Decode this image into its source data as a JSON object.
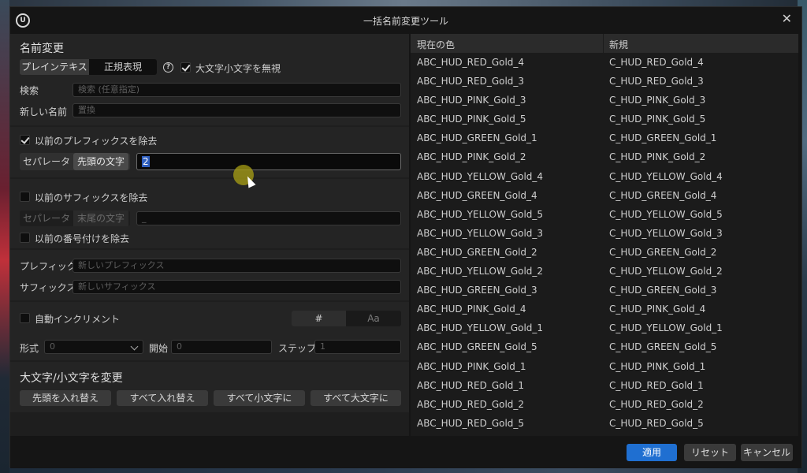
{
  "window": {
    "title": "一括名前変更ツール",
    "logo": "U",
    "close": "✕"
  },
  "rename": {
    "heading": "名前変更",
    "mode_plain": "プレインテキスト",
    "mode_regex": "正規表現",
    "ignore_case": "大文字小文字を無視",
    "search_label": "検索",
    "search_placeholder": "検索 (任意指定)",
    "newname_label": "新しい名前",
    "newname_placeholder": "置換"
  },
  "prefix_remove": {
    "checkbox": "以前のプレフィックスを除去",
    "separator": "セパレータ",
    "leading": "先頭の文字",
    "value": "2"
  },
  "suffix_remove": {
    "checkbox": "以前のサフィックスを除去",
    "separator": "セパレータ",
    "trailing": "末尾の文字",
    "value": "_",
    "numbering": "以前の番号付けを除去"
  },
  "prefix_suffix": {
    "prefix_label": "プレフィック.",
    "prefix_placeholder": "新しいプレフィックス",
    "suffix_label": "サフィックス",
    "suffix_placeholder": "新しいサフィックス"
  },
  "increment": {
    "checkbox": "自動インクリメント",
    "hash": "#",
    "aa": "Aa",
    "format_label": "形式",
    "format_value": "0",
    "start_label": "開始",
    "start_value": "0",
    "step_label": "ステップ",
    "step_value": "1"
  },
  "case": {
    "heading": "大文字/小文字を変更",
    "b1": "先頭を入れ替え",
    "b2": "すべて入れ替え",
    "b3": "すべて小文字に",
    "b4": "すべて大文字に"
  },
  "table": {
    "col_current": "現在の色",
    "col_new": "新規",
    "rows": [
      [
        "ABC_HUD_RED_Gold_4",
        "C_HUD_RED_Gold_4"
      ],
      [
        "ABC_HUD_RED_Gold_3",
        "C_HUD_RED_Gold_3"
      ],
      [
        "ABC_HUD_PINK_Gold_3",
        "C_HUD_PINK_Gold_3"
      ],
      [
        "ABC_HUD_PINK_Gold_5",
        "C_HUD_PINK_Gold_5"
      ],
      [
        "ABC_HUD_GREEN_Gold_1",
        "C_HUD_GREEN_Gold_1"
      ],
      [
        "ABC_HUD_PINK_Gold_2",
        "C_HUD_PINK_Gold_2"
      ],
      [
        "ABC_HUD_YELLOW_Gold_4",
        "C_HUD_YELLOW_Gold_4"
      ],
      [
        "ABC_HUD_GREEN_Gold_4",
        "C_HUD_GREEN_Gold_4"
      ],
      [
        "ABC_HUD_YELLOW_Gold_5",
        "C_HUD_YELLOW_Gold_5"
      ],
      [
        "ABC_HUD_YELLOW_Gold_3",
        "C_HUD_YELLOW_Gold_3"
      ],
      [
        "ABC_HUD_GREEN_Gold_2",
        "C_HUD_GREEN_Gold_2"
      ],
      [
        "ABC_HUD_YELLOW_Gold_2",
        "C_HUD_YELLOW_Gold_2"
      ],
      [
        "ABC_HUD_GREEN_Gold_3",
        "C_HUD_GREEN_Gold_3"
      ],
      [
        "ABC_HUD_PINK_Gold_4",
        "C_HUD_PINK_Gold_4"
      ],
      [
        "ABC_HUD_YELLOW_Gold_1",
        "C_HUD_YELLOW_Gold_1"
      ],
      [
        "ABC_HUD_GREEN_Gold_5",
        "C_HUD_GREEN_Gold_5"
      ],
      [
        "ABC_HUD_PINK_Gold_1",
        "C_HUD_PINK_Gold_1"
      ],
      [
        "ABC_HUD_RED_Gold_1",
        "C_HUD_RED_Gold_1"
      ],
      [
        "ABC_HUD_RED_Gold_2",
        "C_HUD_RED_Gold_2"
      ],
      [
        "ABC_HUD_RED_Gold_5",
        "C_HUD_RED_Gold_5"
      ]
    ]
  },
  "footer": {
    "apply": "適用",
    "reset": "リセット",
    "cancel": "キャンセル"
  },
  "colors": {
    "primary": "#1f6fd1",
    "selection": "#2f5fbf"
  }
}
